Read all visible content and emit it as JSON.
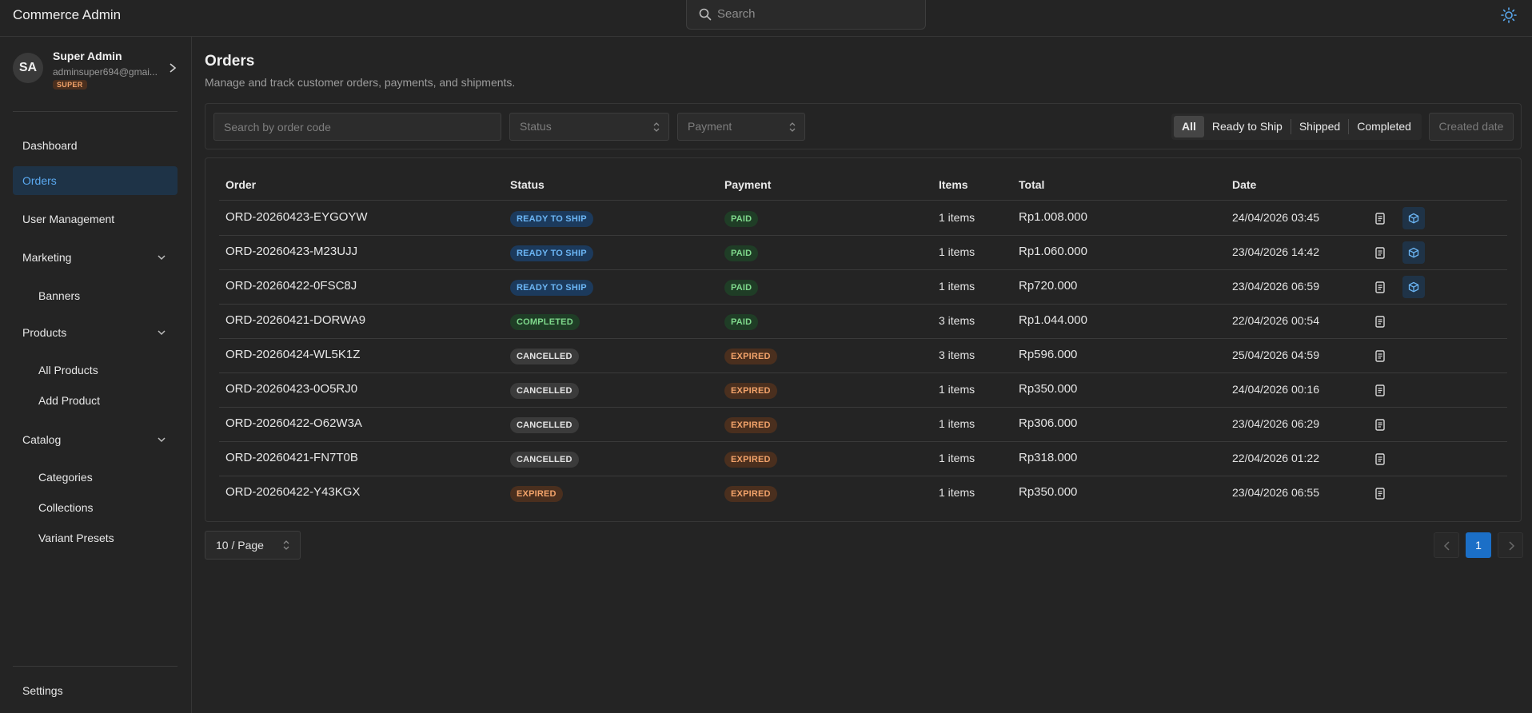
{
  "app": {
    "title": "Commerce Admin"
  },
  "header": {
    "search_placeholder": "Search"
  },
  "user": {
    "initials": "SA",
    "name": "Super Admin",
    "email": "adminsuper694@gmai...",
    "role": "SUPER"
  },
  "sidebar": {
    "items": [
      {
        "label": "Dashboard"
      },
      {
        "label": "Orders",
        "active": true
      },
      {
        "label": "User Management"
      },
      {
        "label": "Marketing",
        "children": [
          {
            "label": "Banners"
          }
        ]
      },
      {
        "label": "Products",
        "children": [
          {
            "label": "All Products"
          },
          {
            "label": "Add Product"
          }
        ]
      },
      {
        "label": "Catalog",
        "children": [
          {
            "label": "Categories"
          },
          {
            "label": "Collections"
          },
          {
            "label": "Variant Presets"
          }
        ]
      }
    ],
    "settings": "Settings"
  },
  "page": {
    "title": "Orders",
    "subtitle": "Manage and track customer orders, payments, and shipments."
  },
  "filters": {
    "search_placeholder": "Search by order code",
    "status_placeholder": "Status",
    "payment_placeholder": "Payment",
    "tabs": [
      "All",
      "Ready to Ship",
      "Shipped",
      "Completed"
    ],
    "active_tab": "All",
    "date_label": "Created date"
  },
  "table": {
    "columns": [
      "Order",
      "Status",
      "Payment",
      "Items",
      "Total",
      "Date"
    ],
    "rows": [
      {
        "code": "ORD-20260423-EYGOYW",
        "status": "READY TO SHIP",
        "payment": "PAID",
        "items": "1 items",
        "total": "Rp1.008.000",
        "date": "24/04/2026 03:45",
        "can_ship": true
      },
      {
        "code": "ORD-20260423-M23UJJ",
        "status": "READY TO SHIP",
        "payment": "PAID",
        "items": "1 items",
        "total": "Rp1.060.000",
        "date": "23/04/2026 14:42",
        "can_ship": true
      },
      {
        "code": "ORD-20260422-0FSC8J",
        "status": "READY TO SHIP",
        "payment": "PAID",
        "items": "1 items",
        "total": "Rp720.000",
        "date": "23/04/2026 06:59",
        "can_ship": true
      },
      {
        "code": "ORD-20260421-DORWA9",
        "status": "COMPLETED",
        "payment": "PAID",
        "items": "3 items",
        "total": "Rp1.044.000",
        "date": "22/04/2026 00:54",
        "can_ship": false
      },
      {
        "code": "ORD-20260424-WL5K1Z",
        "status": "CANCELLED",
        "payment": "EXPIRED",
        "items": "3 items",
        "total": "Rp596.000",
        "date": "25/04/2026 04:59",
        "can_ship": false
      },
      {
        "code": "ORD-20260423-0O5RJ0",
        "status": "CANCELLED",
        "payment": "EXPIRED",
        "items": "1 items",
        "total": "Rp350.000",
        "date": "24/04/2026 00:16",
        "can_ship": false
      },
      {
        "code": "ORD-20260422-O62W3A",
        "status": "CANCELLED",
        "payment": "EXPIRED",
        "items": "1 items",
        "total": "Rp306.000",
        "date": "23/04/2026 06:29",
        "can_ship": false
      },
      {
        "code": "ORD-20260421-FN7T0B",
        "status": "CANCELLED",
        "payment": "EXPIRED",
        "items": "1 items",
        "total": "Rp318.000",
        "date": "22/04/2026 01:22",
        "can_ship": false
      },
      {
        "code": "ORD-20260422-Y43KGX",
        "status": "EXPIRED",
        "payment": "EXPIRED",
        "items": "1 items",
        "total": "Rp350.000",
        "date": "23/04/2026 06:55",
        "can_ship": false
      }
    ]
  },
  "badge_colors": {
    "READY TO SHIP": {
      "bg": "#1c3a5c",
      "fg": "#6cb6f5"
    },
    "PAID": {
      "bg": "#1f3d26",
      "fg": "#7fd98c"
    },
    "COMPLETED": {
      "bg": "#1f3d26",
      "fg": "#7fd98c"
    },
    "CANCELLED": {
      "bg": "#3b3b3b",
      "fg": "#e4e4e4"
    },
    "EXPIRED": {
      "bg": "#4a2f1e",
      "fg": "#f3a36a"
    }
  },
  "pagination": {
    "page_size": "10 / Page",
    "current_page": "1"
  },
  "colors": {
    "accent": "#1b6fc7",
    "active_nav_bg": "#1e3347",
    "active_nav_fg": "#5aa9f0"
  }
}
